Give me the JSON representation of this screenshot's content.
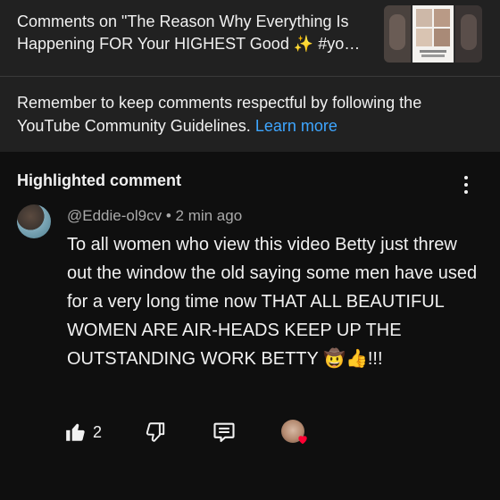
{
  "header": {
    "title": "Comments on \"The Reason Why Everything Is Happening FOR Your HIGHEST Good ✨ #yo…",
    "guidelines_text": "Remember to keep comments respectful by following the YouTube Community Guidelines.",
    "learn_more": "Learn more"
  },
  "highlighted": {
    "label": "Highlighted comment"
  },
  "comment": {
    "author": "@Eddie-ol9cv",
    "separator": "•",
    "time": "2 min ago",
    "text": "To all women who view this video Betty just threw out the window the old saying some men have used for a very long time now THAT ALL BEAUTIFUL WOMEN ARE AIR-HEADS KEEP UP THE OUTSTANDING WORK BETTY 🤠👍!!!",
    "like_count": "2"
  },
  "icons": {
    "more": "vertical-dots-icon",
    "like": "thumb-up-icon",
    "dislike": "thumb-down-icon",
    "reply": "reply-comment-icon",
    "creator_heart": "creator-heart-icon"
  },
  "colors": {
    "background": "#0f0f0f",
    "header_background": "#212121",
    "link": "#3ea6ff",
    "heart": "#ff0033",
    "meta_text": "#aaaaaa"
  }
}
